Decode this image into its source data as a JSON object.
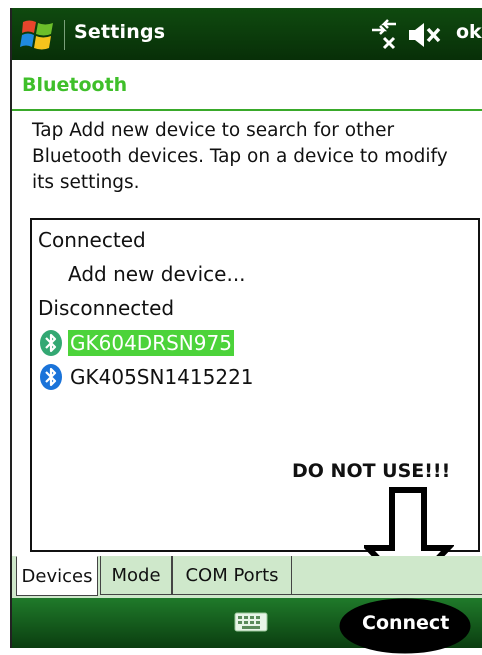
{
  "titlebar": {
    "title": "Settings",
    "ok_label": "ok",
    "icons": [
      "windows-logo-icon",
      "connectivity-icon",
      "volume-muted-icon"
    ]
  },
  "section": {
    "title": "Bluetooth"
  },
  "description": "Tap Add new device to search for other Bluetooth devices. Tap on a device to modify its settings.",
  "device_list": {
    "connected_header": "Connected",
    "add_new": "Add new device...",
    "disconnected_header": "Disconnected",
    "devices": [
      {
        "name": "GK604DRSN975",
        "selected": true,
        "icon": "bluetooth-icon"
      },
      {
        "name": "GK405SN1415221",
        "selected": false,
        "icon": "bluetooth-icon"
      }
    ]
  },
  "annotation": {
    "text": "DO NOT USE!!!"
  },
  "tabs": [
    {
      "label": "Devices",
      "active": true
    },
    {
      "label": "Mode",
      "active": false
    },
    {
      "label": "COM Ports",
      "active": false
    }
  ],
  "softbar": {
    "right_label": "Connect",
    "center_icon": "keyboard-icon"
  },
  "colors": {
    "titlebar": "#0f4a0f",
    "accent_green": "#3fbf2a",
    "selection": "#4cd33a",
    "bluetooth_blue": "#1a73d9",
    "tab_bg": "#cfe8cb"
  }
}
